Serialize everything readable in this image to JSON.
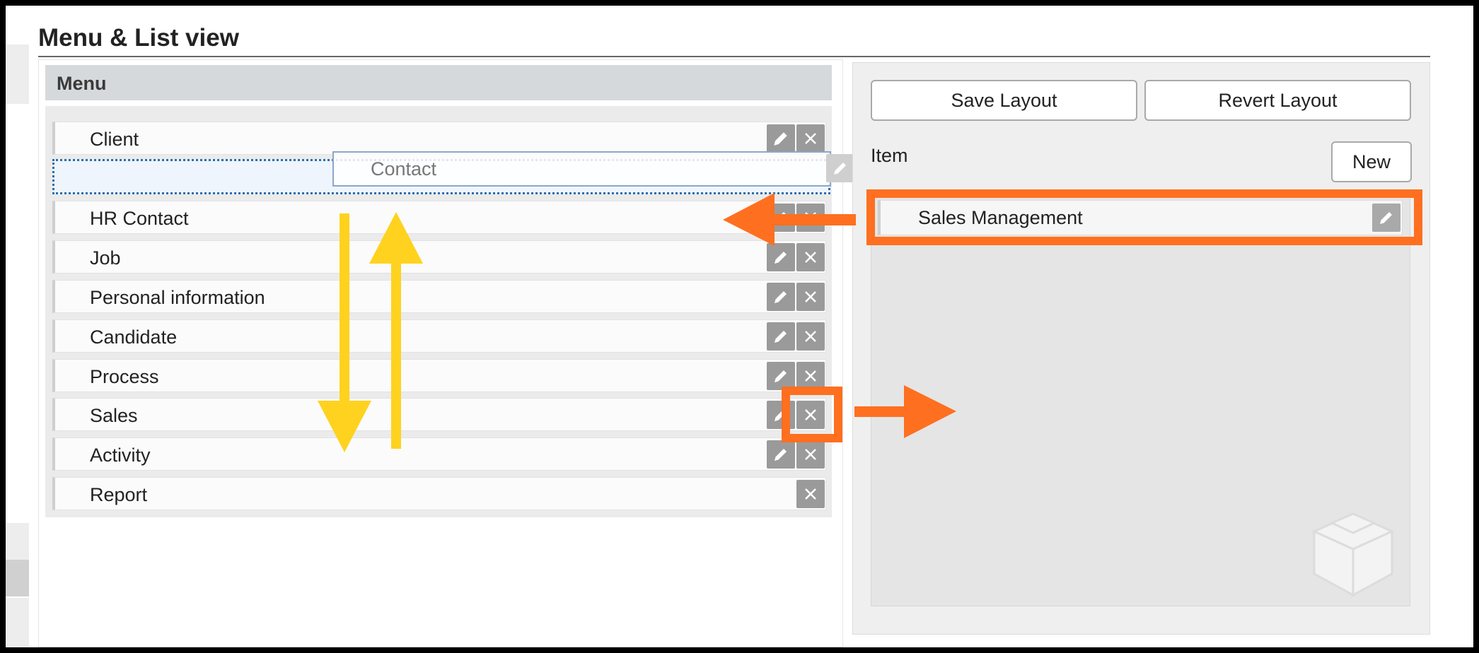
{
  "page_title": "Menu & List view",
  "menu": {
    "header": "Menu",
    "items": [
      {
        "label": "Client",
        "editable": true
      },
      {
        "label": "HR Contact",
        "editable": true
      },
      {
        "label": "Job",
        "editable": true
      },
      {
        "label": "Personal information",
        "editable": true
      },
      {
        "label": "Candidate",
        "editable": true
      },
      {
        "label": "Process",
        "editable": true
      },
      {
        "label": "Sales",
        "editable": true
      },
      {
        "label": "Activity",
        "editable": true
      },
      {
        "label": "Report",
        "editable": false
      }
    ],
    "dragging_item": "Contact"
  },
  "right_panel": {
    "save_label": "Save Layout",
    "revert_label": "Revert Layout",
    "item_label": "Item",
    "new_label": "New",
    "items": [
      {
        "label": "Sales Management"
      }
    ]
  },
  "colors": {
    "highlight": "#ff6f20",
    "arrow_yellow": "#ffd21f",
    "icon_button": "#9a9a9a"
  }
}
